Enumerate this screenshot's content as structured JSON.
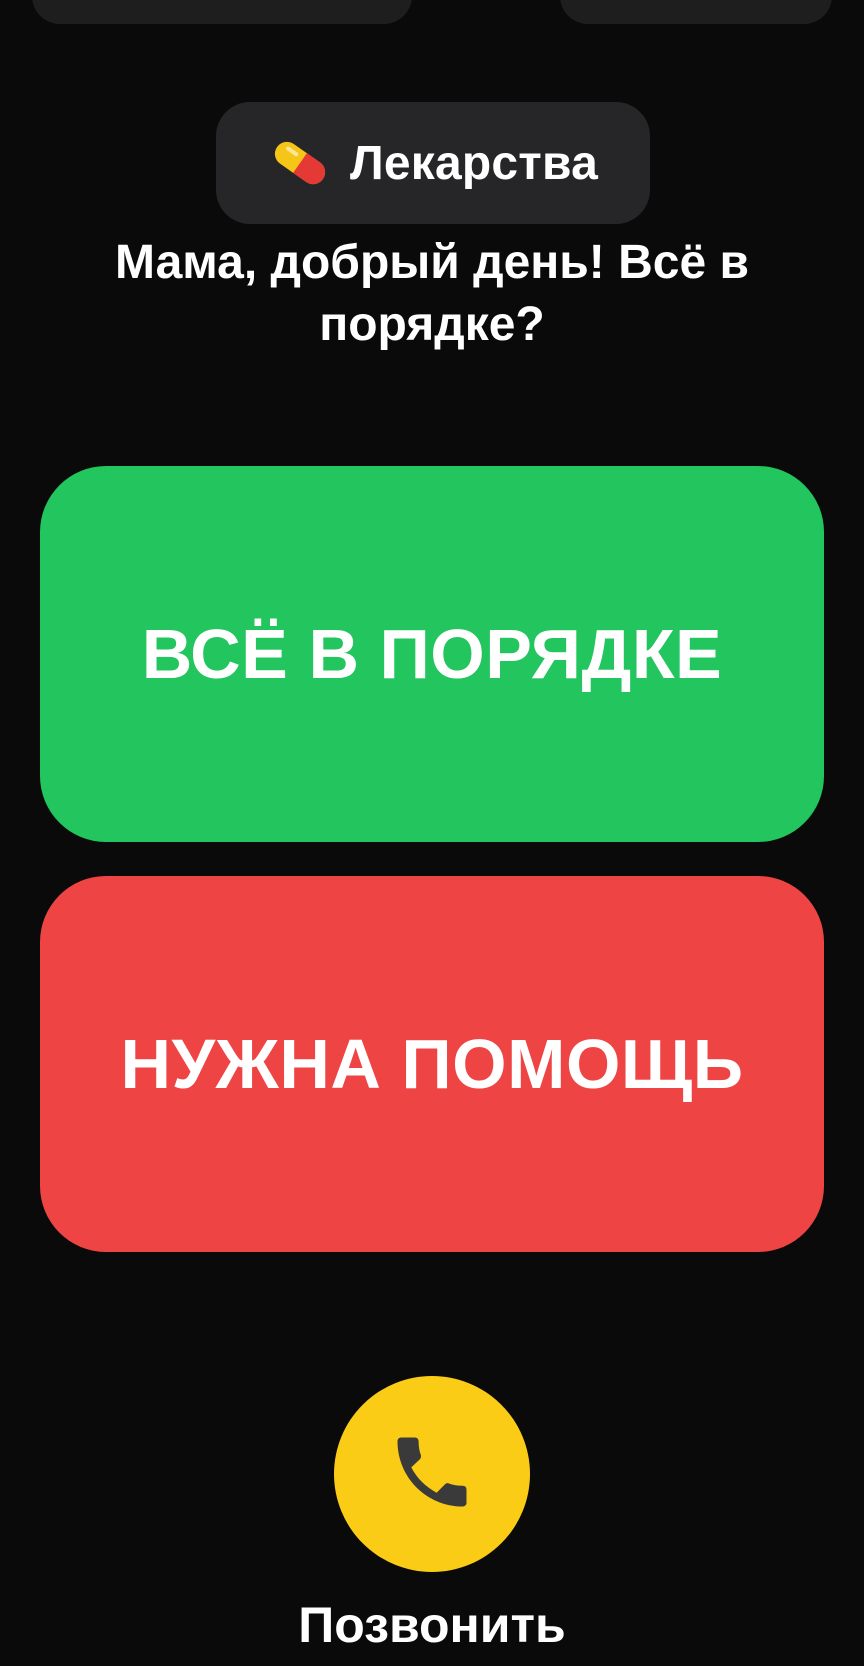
{
  "header": {
    "chip_icon": "pill-icon",
    "chip_label": "Лекарства"
  },
  "greeting": {
    "text": "Мама, добрый день! Всё в порядке?"
  },
  "actions": {
    "ok_label": "ВСЁ В ПОРЯДКЕ",
    "ok_color": "#22c55e",
    "help_label": "НУЖНА ПОМОЩЬ",
    "help_color": "#ef4444"
  },
  "call": {
    "icon": "phone-icon",
    "label": "Позвонить",
    "color": "#facc15"
  },
  "theme": {
    "background": "#0a0a0a",
    "chip_background": "#262628"
  }
}
